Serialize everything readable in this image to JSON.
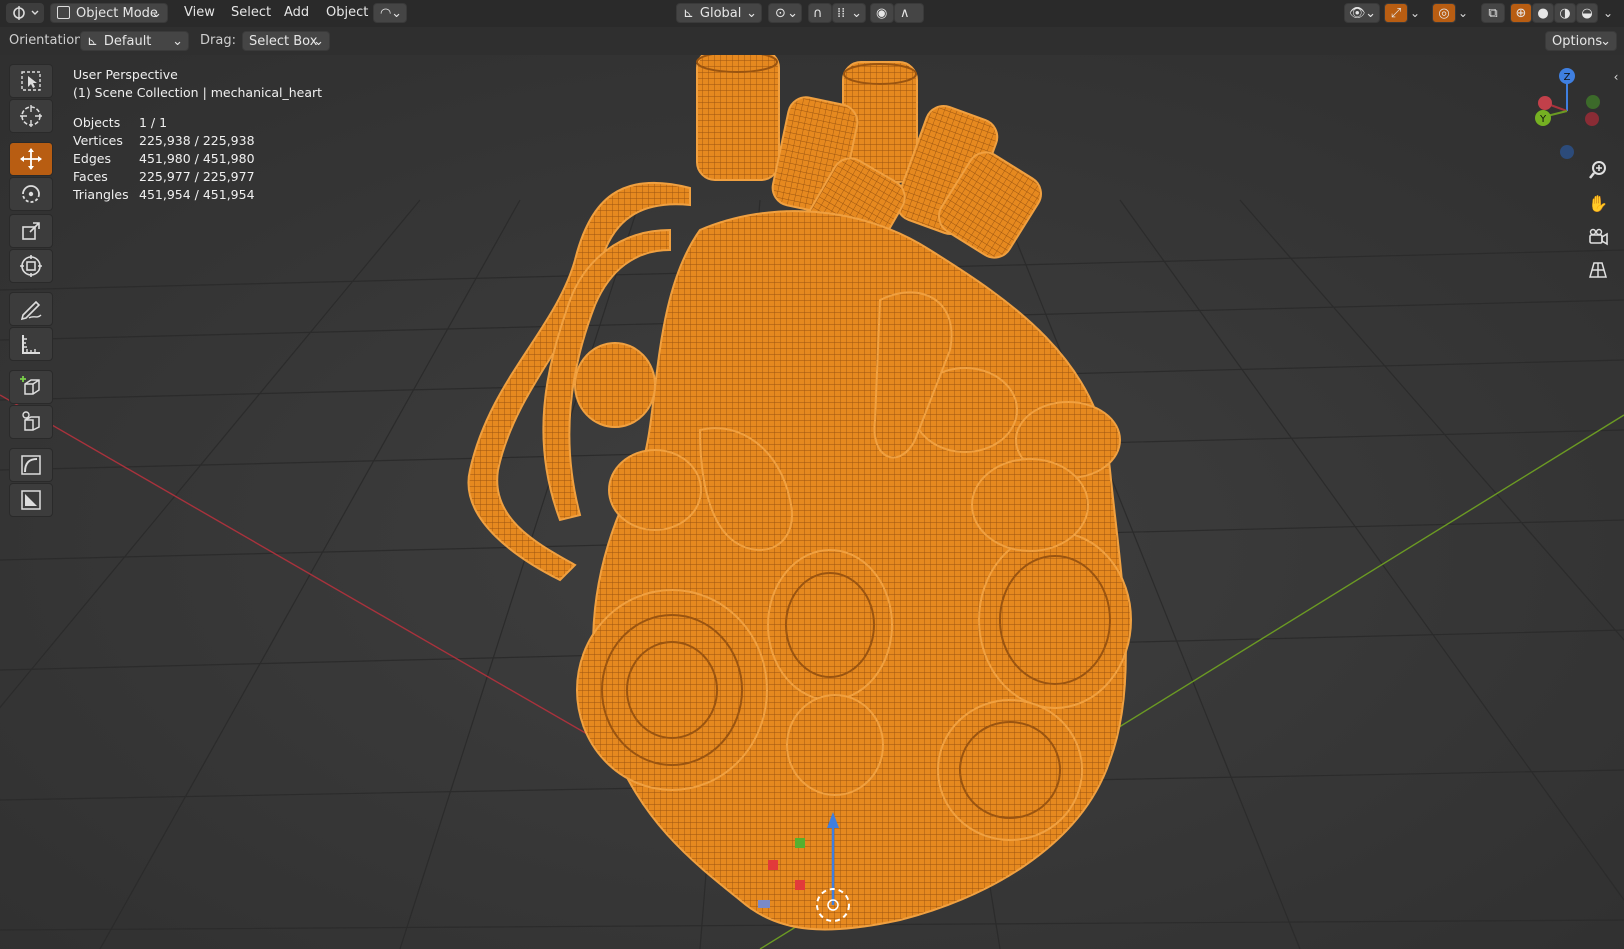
{
  "header": {
    "mode_label": "Object Mode",
    "menus": [
      "View",
      "Select",
      "Add",
      "Object"
    ],
    "transform_orientation": "Global"
  },
  "tool_settings": {
    "orientation_label": "Orientation:",
    "orientation_value": "Default",
    "drag_label": "Drag:",
    "drag_value": "Select Box",
    "options_label": "Options"
  },
  "viewport_info": {
    "perspective": "User Perspective",
    "collection": "(1) Scene Collection | mechanical_heart",
    "stats": [
      {
        "key": "Objects",
        "value": "1 / 1"
      },
      {
        "key": "Vertices",
        "value": "225,938 / 225,938"
      },
      {
        "key": "Edges",
        "value": "451,980 / 451,980"
      },
      {
        "key": "Faces",
        "value": "225,977 / 225,977"
      },
      {
        "key": "Triangles",
        "value": "451,954 / 451,954"
      }
    ]
  },
  "gizmo": {
    "z": "Z",
    "y": "Y"
  },
  "tools": [
    "select-box-tool",
    "cursor-tool",
    "move-tool",
    "rotate-tool",
    "scale-tool",
    "transform-tool",
    "annotate-tool",
    "measure-tool",
    "add-cube-tool",
    "extrude-tool",
    "curve-tool",
    "image-tool"
  ],
  "colors": {
    "accent": "#e6891f",
    "active_tool": "#b85d12",
    "x_axis": "#a8323c",
    "y_axis": "#6b9a23"
  }
}
